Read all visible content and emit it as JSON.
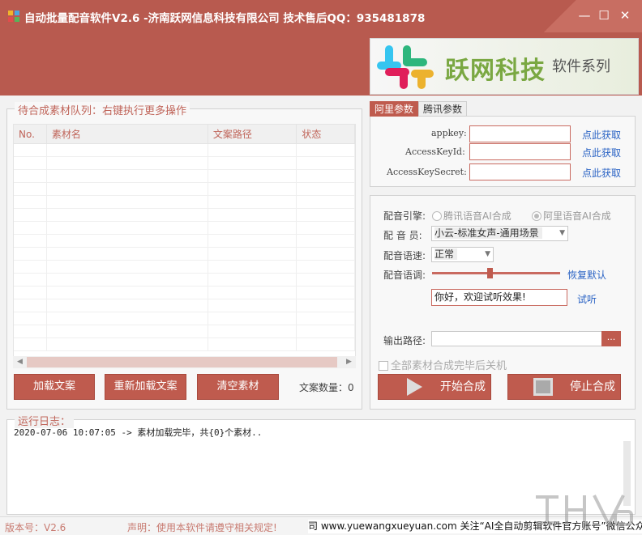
{
  "window": {
    "title": "自动批量配音软件V2.6 -济南跃网信息科技有限公司 技术售后QQ：935481878",
    "minimize": "—",
    "maximize": "☐",
    "close": "✕"
  },
  "banner": {
    "brand": "跃网科技",
    "subtitle": "软件系列"
  },
  "queue": {
    "title": "待合成素材队列：右键执行更多操作",
    "columns": [
      "No.",
      "素材名",
      "文案路径",
      "状态"
    ],
    "buttons": {
      "load": "加载文案",
      "reload": "重新加载文案",
      "clear": "清空素材"
    },
    "count_label": "文案数量：0"
  },
  "params": {
    "tabs": [
      "阿里参数",
      "腾讯参数"
    ],
    "fields": [
      {
        "label": "appkey:",
        "value": "",
        "link": "点此获取"
      },
      {
        "label": "AccessKeyId:",
        "value": "",
        "link": "点此获取"
      },
      {
        "label": "AccessKeySecret:",
        "value": "",
        "link": "点此获取"
      }
    ]
  },
  "voice": {
    "engine_label": "配音引擎:",
    "engine_options": [
      "腾讯语音AI合成",
      "阿里语音AI合成"
    ],
    "engine_selected": "阿里语音AI合成",
    "voice_label": "配 音 员:",
    "voice_value": "小云-标准女声-通用场景",
    "speed_label": "配音语速:",
    "speed_value": "正常",
    "pitch_label": "配音语调:",
    "pitch_level": 0.45,
    "reset_link": "恢复默认",
    "preview_text": "你好，欢迎试听效果!",
    "preview_link": "试听",
    "output_label": "输出路径:",
    "output_value": "",
    "browse": "...",
    "shutdown_label": "全部素材合成完毕后关机",
    "start": "开始合成",
    "stop": "停止合成"
  },
  "log": {
    "title": "运行日志：",
    "lines": [
      "2020-07-06 10:07:05 -> 素材加载完毕，共{0}个素材.."
    ]
  },
  "status": {
    "version": "版本号：V2.6",
    "notice": "声明：使用本软件请遵守相关规定!",
    "marquee": "司 www.yuewangxueyuan.com 关注“AI全自动剪辑软件官方账号”微信公众号获"
  },
  "colors": {
    "accent": "#bf5b4e",
    "link": "#2962c4",
    "brand_green": "#7aa842"
  }
}
